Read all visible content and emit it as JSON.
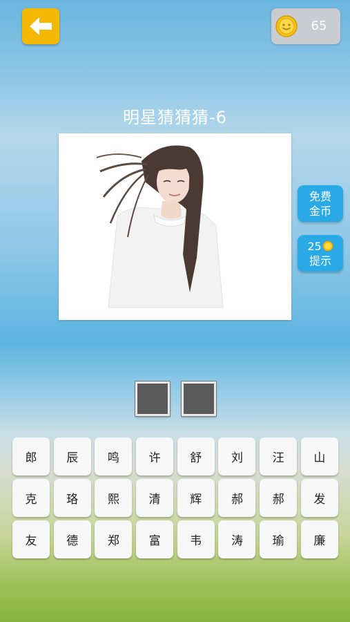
{
  "header": {
    "back_icon": "arrow-left-icon",
    "coin_icon": "coin-icon",
    "coin_count": "65"
  },
  "title": "明星猜猜猜-6",
  "side_buttons": {
    "free_coins_line1": "免费",
    "free_coins_line2": "金币",
    "hint_cost": "25",
    "hint_label": "提示"
  },
  "answer_slots": [
    "",
    ""
  ],
  "keys": [
    "郎",
    "辰",
    "鸣",
    "许",
    "舒",
    "刘",
    "汪",
    "山",
    "克",
    "珞",
    "熙",
    "清",
    "辉",
    "郝",
    "郝",
    "发",
    "友",
    "德",
    "郑",
    "富",
    "韦",
    "涛",
    "瑜",
    "廉"
  ],
  "colors": {
    "back_button": "#f5b800",
    "side_button": "#29a9e6",
    "answer_slot": "#5b5b5b"
  }
}
